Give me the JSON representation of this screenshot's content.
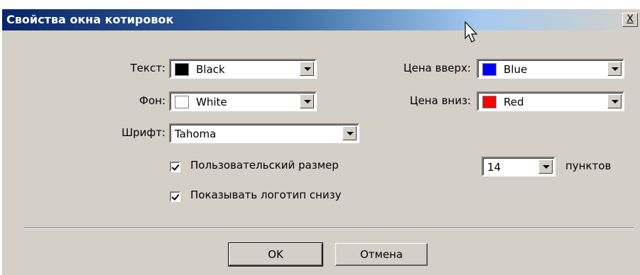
{
  "dialog": {
    "title": "Свойства окна котировок",
    "close_label": "X"
  },
  "text_color": {
    "label": "Текст:",
    "value": "Black",
    "swatch": "#000000"
  },
  "bg_color": {
    "label": "Фон:",
    "value": "White",
    "swatch": "#ffffff"
  },
  "font": {
    "label": "Шрифт:",
    "value": "Tahoma"
  },
  "price_up": {
    "label": "Цена вверх:",
    "value": "Blue",
    "swatch": "#0000ff"
  },
  "price_down": {
    "label": "Цена вниз:",
    "value": "Red",
    "swatch": "#ff0000"
  },
  "custom_size": {
    "label": "Пользовательский размер",
    "checked": true
  },
  "show_logo": {
    "label": "Показывать логотип снизу",
    "checked": true
  },
  "size": {
    "value": "14",
    "unit": "пунктов"
  },
  "buttons": {
    "ok": "OK",
    "cancel": "Отмена"
  },
  "icons": {
    "cursor": "mouse-pointer-icon",
    "dropdown": "chevron-down-icon"
  }
}
